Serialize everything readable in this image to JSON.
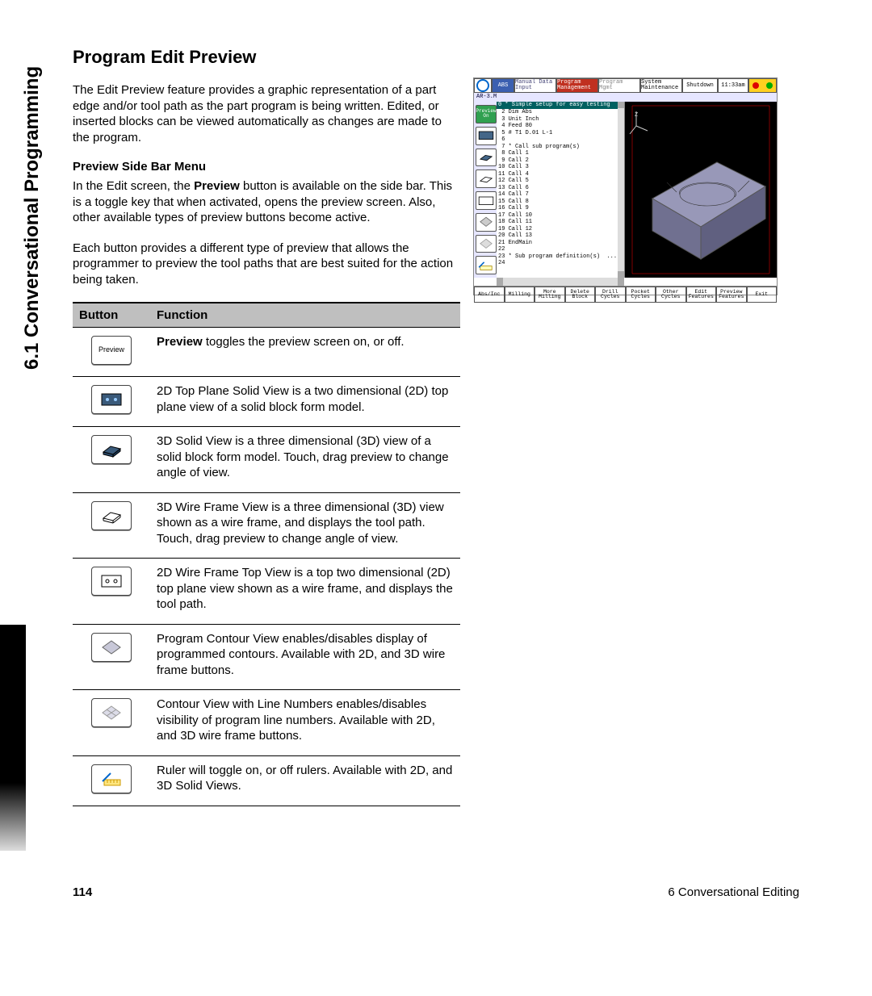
{
  "side_tab": "6.1 Conversational Programming",
  "heading": "Program Edit Preview",
  "intro": "The Edit Preview feature provides a graphic representation of a part edge and/or tool path as the part program is being written. Edited, or inserted blocks can be viewed automatically as changes are made to the program.",
  "sub_heading": "Preview Side Bar Menu",
  "sub_p1a": "In the Edit screen, the ",
  "sub_p1b": "Preview",
  "sub_p1c": " button is available on the side bar.  This is a toggle key that when activated, opens the preview screen.  Also, other available types of preview buttons become active.",
  "sub_p2": "Each button provides a different type of preview that allows the programmer to preview the tool paths that are best suited for the action being taken.",
  "table": {
    "h_button": "Button",
    "h_function": "Function",
    "rows": [
      {
        "icon": "preview",
        "f_pre": "Preview",
        "f_rest": " toggles the preview screen on, or off."
      },
      {
        "icon": "solid2d",
        "f": "2D Top Plane Solid View is a two dimensional (2D) top plane view of a solid block form model."
      },
      {
        "icon": "solid3d",
        "f": "3D Solid View is a three dimensional (3D) view of a solid block form model. Touch, drag preview to change angle of view."
      },
      {
        "icon": "wire3d",
        "f": "3D Wire Frame View is a three dimensional (3D) view shown as a wire frame, and displays the tool path. Touch, drag preview to change angle of view."
      },
      {
        "icon": "wire2d",
        "f": "2D Wire Frame Top View is a top two dimensional (2D) top plane view shown as a wire frame, and displays the tool path."
      },
      {
        "icon": "contour",
        "f": "Program Contour View enables/disables display of programmed contours. Available with 2D, and 3D wire frame buttons."
      },
      {
        "icon": "contourln",
        "f": "Contour View with Line Numbers enables/disables visibility of program line numbers. Available with 2D, and 3D wire frame buttons."
      },
      {
        "icon": "ruler",
        "f": " Ruler will toggle on, or off rulers.  Available with 2D, and 3D Solid Views."
      }
    ]
  },
  "figure": {
    "topbar": {
      "abs": "ABS",
      "mdi": "Manual Data Input",
      "prog": "Program Management",
      "pmgr": "Program Mgmt",
      "sys": "System Maintenance",
      "shut": "Shutdown",
      "time": "11:33am"
    },
    "filename": "AR-3.M",
    "preview_on": "Preview On",
    "code_hi": "0 * Simple setup for easy testing",
    "code": [
      " 2 Dim Abs",
      " 3 Unit Inch",
      " 4 Feed 80",
      " 5 # T1 D.01 L-1",
      " 6",
      " 7 * Call sub program(s)",
      " 8 Call 1",
      " 9 Call 2",
      "10 Call 3",
      "11 Call 4",
      "12 Call 5",
      "13 Call 6",
      "14 Call 7",
      "15 Call 8",
      "16 Call 9",
      "17 Call 10",
      "18 Call 11",
      "19 Call 12",
      "20 Call 13",
      "21 EndMain",
      "22",
      "23 * Sub program definition(s)  ...",
      "24"
    ],
    "bottombar": [
      "Abs/Inc",
      "Milling",
      "More Milling",
      "Delete Block",
      "Drill Cycles",
      "Pocket Cycles",
      "Other Cycles",
      "Edit Features",
      "Preview Features",
      "Exit"
    ]
  },
  "footer": {
    "page": "114",
    "chapter": "6 Conversational Editing"
  }
}
